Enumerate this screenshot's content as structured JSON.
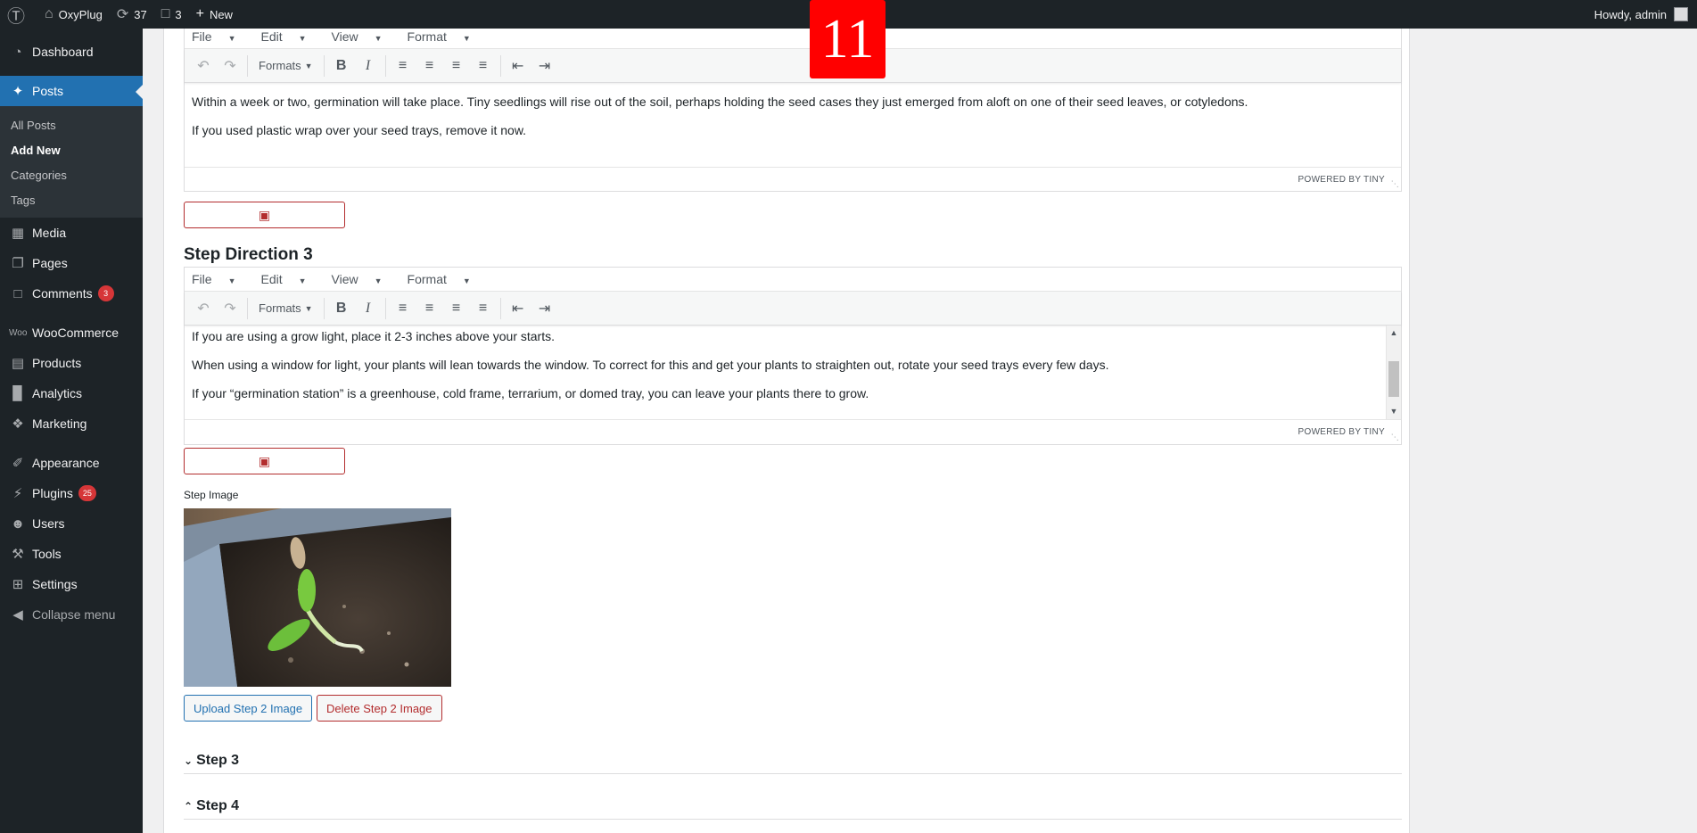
{
  "adminbar": {
    "site_name": "OxyPlug",
    "updates_count": "37",
    "comments_count": "3",
    "new_label": "New",
    "greeting": "Howdy, admin"
  },
  "sidebar": {
    "dashboard": "Dashboard",
    "posts": "Posts",
    "posts_sub": [
      "All Posts",
      "Add New",
      "Categories",
      "Tags"
    ],
    "media": "Media",
    "pages": "Pages",
    "comments": "Comments",
    "comments_badge": "3",
    "woocommerce": "WooCommerce",
    "products": "Products",
    "analytics": "Analytics",
    "marketing": "Marketing",
    "appearance": "Appearance",
    "plugins": "Plugins",
    "plugins_badge": "25",
    "users": "Users",
    "tools": "Tools",
    "settings": "Settings",
    "collapse": "Collapse menu"
  },
  "overlay_number": "11",
  "editor_menu": {
    "file": "File",
    "edit": "Edit",
    "view": "View",
    "format": "Format"
  },
  "toolbar": {
    "formats": "Formats"
  },
  "editor1": {
    "paragraphs": [
      "Within a week or two, germination will take place. Tiny seedlings will rise out of the soil, perhaps holding the seed cases they just emerged from aloft on one of their seed leaves, or cotyledons.",
      "If you used plastic wrap over your seed trays, remove it now."
    ],
    "powered": "POWERED BY TINY"
  },
  "step_direction_3": {
    "title": "Step Direction 3",
    "paragraphs": [
      "If you are using a grow light, place it 2-3 inches above your starts.",
      "When using a window for light, your plants will lean towards the window. To correct for this and get your plants to straighten out, rotate your seed trays every few days.",
      "If your “germination station” is a greenhouse, cold frame, terrarium, or domed tray, you can leave your plants there to grow."
    ],
    "powered": "POWERED BY TINY"
  },
  "step_image": {
    "label": "Step Image",
    "upload": "Upload Step 2 Image",
    "delete": "Delete Step 2 Image"
  },
  "accordions": {
    "step3": "Step 3",
    "step4": "Step 4"
  },
  "colors": {
    "admin_dark": "#1d2327",
    "accent_blue": "#2271b1",
    "danger_red": "#b32d2e",
    "badge_red": "#d63638"
  }
}
